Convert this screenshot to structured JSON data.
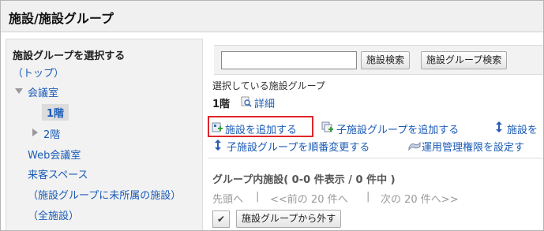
{
  "page_title": "施設/施設グループ",
  "sidebar": {
    "heading": "施設グループを選択する",
    "items": [
      {
        "label": "（トップ）"
      },
      {
        "label": "会議室"
      },
      {
        "label": "1階"
      },
      {
        "label": "2階"
      },
      {
        "label": "Web会議室"
      },
      {
        "label": "来客スペース"
      },
      {
        "label": "（施設グループに未所属の施設）"
      },
      {
        "label": "（全施設）"
      }
    ]
  },
  "search": {
    "value": "",
    "placeholder": "",
    "facility_search_label": "施設検索",
    "group_search_label": "施設グループ検索"
  },
  "selected_group": {
    "caption": "選択している施設グループ",
    "name": "1階",
    "detail_label": "詳細"
  },
  "actions": {
    "add_facility": "施設を追加する",
    "add_child_group": "子施設グループを追加する",
    "reorder_facilities": "施設を",
    "reorder_child_groups": "子施設グループを順番変更する",
    "set_admin_rights": "運用管理権限を設定す"
  },
  "facility_list": {
    "title": "グループ内施設( 0-0 件表示 / 0 件中 )",
    "pager_first": "先頭へ",
    "pager_prev": "<<前の 20 件へ",
    "pager_next": "次の 20 件へ>>",
    "separator": "|",
    "check_mark": "✔",
    "remove_label": "施設グループから外す"
  },
  "colors": {
    "link": "#1a5bb5",
    "highlight": "#e0262a"
  }
}
